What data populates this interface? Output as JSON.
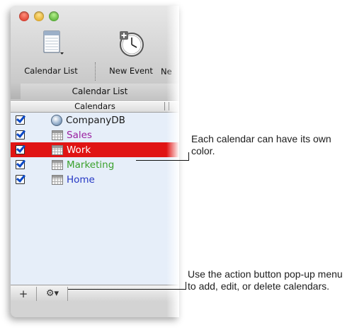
{
  "toolbar": {
    "calendar_list_label": "Calendar List",
    "new_event_label": "New Event",
    "truncated_label": "Ne"
  },
  "tab": {
    "label": "Calendar List"
  },
  "list": {
    "header": "Calendars",
    "items": [
      {
        "label": "CompanyDB",
        "color": "#1a1a1a",
        "icon": "server-icon",
        "checked": true,
        "selected": false
      },
      {
        "label": "Sales",
        "color": "#9a1fa0",
        "icon": "calendar-icon",
        "checked": true,
        "selected": false
      },
      {
        "label": "Work",
        "color": "#ffffff",
        "icon": "calendar-icon",
        "checked": true,
        "selected": true
      },
      {
        "label": "Marketing",
        "color": "#3aa12c",
        "icon": "calendar-icon",
        "checked": true,
        "selected": false
      },
      {
        "label": "Home",
        "color": "#2537c4",
        "icon": "calendar-icon",
        "checked": true,
        "selected": false
      }
    ]
  },
  "bottom_bar": {
    "add_label": "+",
    "action_label": "⚙▾"
  },
  "callouts": {
    "color_note": "Each calendar can have its own color.",
    "action_note": "Use the action button pop-up menu to add, edit, or delete calendars."
  }
}
